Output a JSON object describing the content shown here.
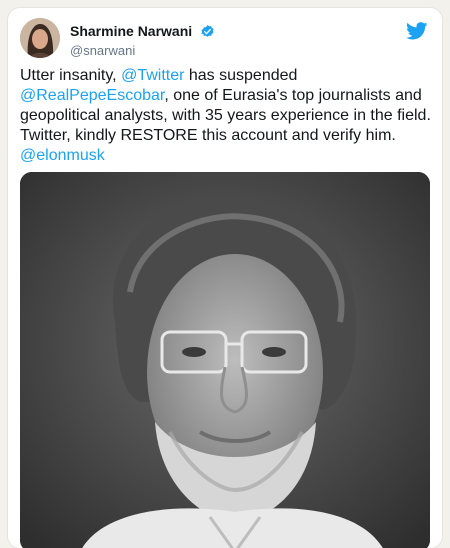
{
  "tweet": {
    "author": {
      "name": "Sharmine Narwani",
      "handle": "@snarwani",
      "verified": true
    },
    "text_parts": [
      {
        "t": "Utter insanity, ",
        "mention": false
      },
      {
        "t": "@Twitter",
        "mention": true
      },
      {
        "t": " has suspended ",
        "mention": false
      },
      {
        "t": "@RealPepeEscobar",
        "mention": true
      },
      {
        "t": ", one of Eurasia's top journalists and geopolitical analysts, with 35 years experience in the field. Twitter, kindly RESTORE this account and verify him. ",
        "mention": false
      },
      {
        "t": "@elonmusk",
        "mention": true
      }
    ]
  },
  "colors": {
    "link": "#1da1f2",
    "text": "#14171a",
    "handle": "#657786",
    "verified": "#1da1f2"
  },
  "icons": {
    "brand": "twitter-bird-icon",
    "verified": "verified-badge-icon"
  }
}
